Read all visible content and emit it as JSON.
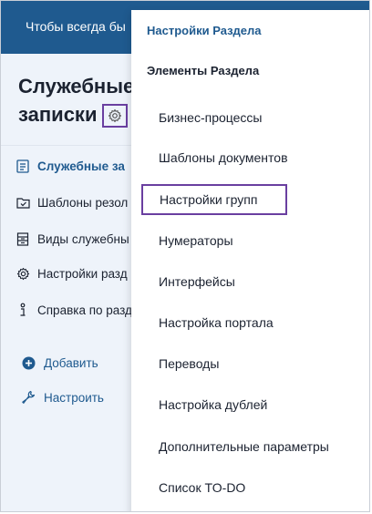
{
  "topbar": {
    "text": "Чтобы всегда бы"
  },
  "page": {
    "title": "Служебные записки"
  },
  "sidebar": {
    "items": [
      {
        "label": "Служебные за",
        "icon": "document-list-icon",
        "active": true
      },
      {
        "label": "Шаблоны резол",
        "icon": "folder-check-icon",
        "active": false
      },
      {
        "label": "Виды служебны",
        "icon": "file-stack-icon",
        "active": false
      },
      {
        "label": "Настройки разд",
        "icon": "gear-icon",
        "active": false
      },
      {
        "label": "Справка по разд",
        "icon": "info-icon",
        "active": false
      }
    ],
    "actions": [
      {
        "label": "Добавить",
        "icon": "plus-circle-icon"
      },
      {
        "label": "Настроить",
        "icon": "wrench-icon"
      }
    ]
  },
  "menu": {
    "header": "Настройки Раздела",
    "subheader": "Элементы Раздела",
    "items": [
      "Бизнес-процессы",
      "Шаблоны документов",
      "Настройки групп",
      "Нумераторы",
      "Интерфейсы",
      "Настройка портала",
      "Переводы",
      "Настройка дублей",
      "Дополнительные параметры",
      "Список TO-DO"
    ],
    "highlighted_index": 2
  },
  "colors": {
    "brand": "#1f5a8f",
    "highlight_border": "#6a3fa0",
    "sidebar_bg": "#eef3fa"
  }
}
